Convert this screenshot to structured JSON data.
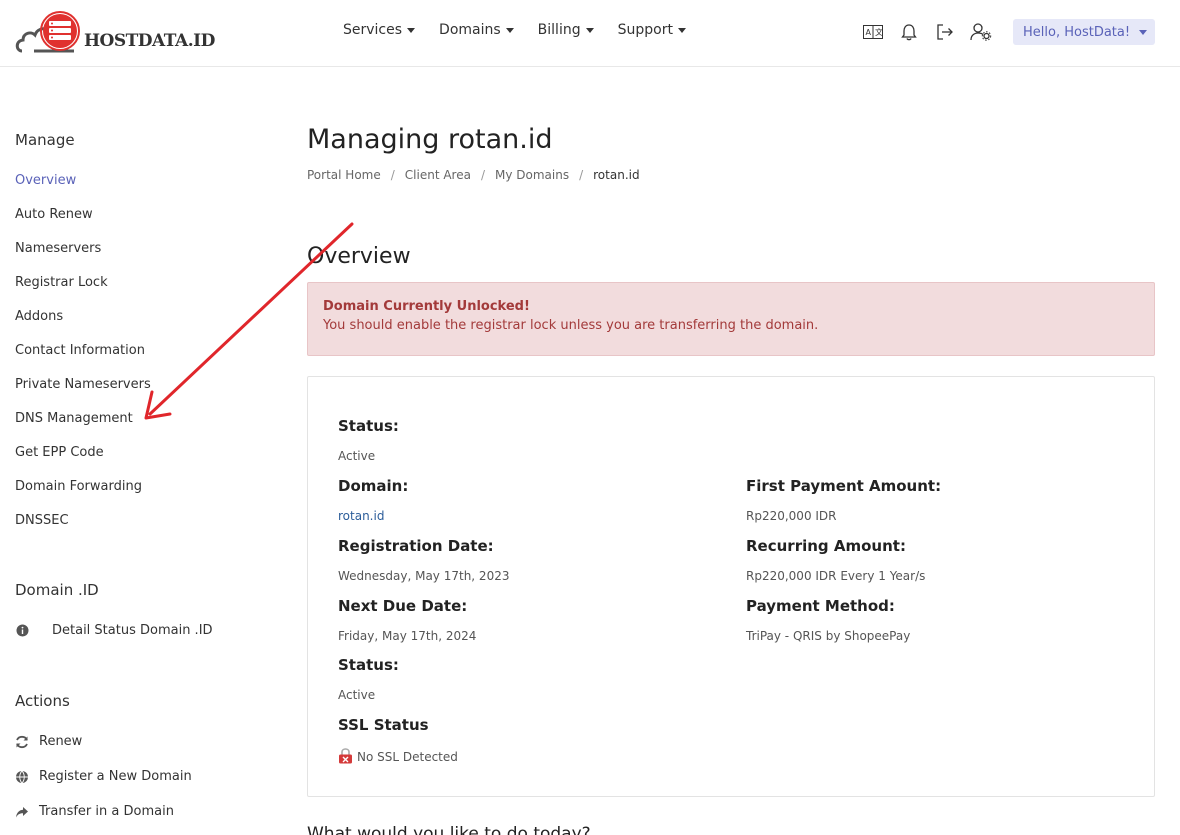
{
  "brand": {
    "logo_text": "HOSTDATA.ID",
    "accent": "#e0312f"
  },
  "nav": [
    {
      "label": "Services"
    },
    {
      "label": "Domains"
    },
    {
      "label": "Billing"
    },
    {
      "label": "Support"
    }
  ],
  "header_icons": [
    "language-icon",
    "bell-icon",
    "logout-icon",
    "user-settings-icon"
  ],
  "user": {
    "greeting": "Hello, HostData!"
  },
  "sidebar": {
    "manage_heading": "Manage",
    "manage_items": [
      {
        "label": "Overview",
        "active": true
      },
      {
        "label": "Auto Renew"
      },
      {
        "label": "Nameservers"
      },
      {
        "label": "Registrar Lock"
      },
      {
        "label": "Addons"
      },
      {
        "label": "Contact Information"
      },
      {
        "label": "Private Nameservers"
      },
      {
        "label": "DNS Management"
      },
      {
        "label": "Get EPP Code"
      },
      {
        "label": "Domain Forwarding"
      },
      {
        "label": "DNSSEC"
      }
    ],
    "domain_heading": "Domain .ID",
    "domain_items": [
      {
        "label": "Detail Status Domain .ID",
        "icon": "info-icon"
      }
    ],
    "actions_heading": "Actions",
    "actions_items": [
      {
        "label": "Renew",
        "icon": "refresh-icon"
      },
      {
        "label": "Register a New Domain",
        "icon": "globe-icon"
      },
      {
        "label": "Transfer in a Domain",
        "icon": "share-icon"
      }
    ]
  },
  "main": {
    "title": "Managing rotan.id",
    "breadcrumb": [
      "Portal Home",
      "Client Area",
      "My Domains",
      "rotan.id"
    ],
    "section_title": "Overview",
    "alert": {
      "title": "Domain Currently Unlocked!",
      "message": "You should enable the registrar lock unless you are transferring the domain."
    },
    "details": {
      "status_label": "Status:",
      "status_value": "Active",
      "domain_label": "Domain:",
      "domain_value": "rotan.id",
      "reg_date_label": "Registration Date:",
      "reg_date_value": "Wednesday, May 17th, 2023",
      "next_due_label": "Next Due Date:",
      "next_due_value": "Friday, May 17th, 2024",
      "status2_label": "Status:",
      "status2_value": "Active",
      "ssl_label": "SSL Status",
      "ssl_value": "No SSL Detected",
      "first_payment_label": "First Payment Amount:",
      "first_payment_value": "Rp220,000 IDR",
      "recurring_label": "Recurring Amount:",
      "recurring_value": "Rp220,000 IDR Every 1 Year/s",
      "payment_method_label": "Payment Method:",
      "payment_method_value": "TriPay - QRIS by ShopeePay"
    },
    "bottom_question": "What would you like to do today?"
  },
  "annotation": {
    "arrow_color": "#e0262b"
  }
}
